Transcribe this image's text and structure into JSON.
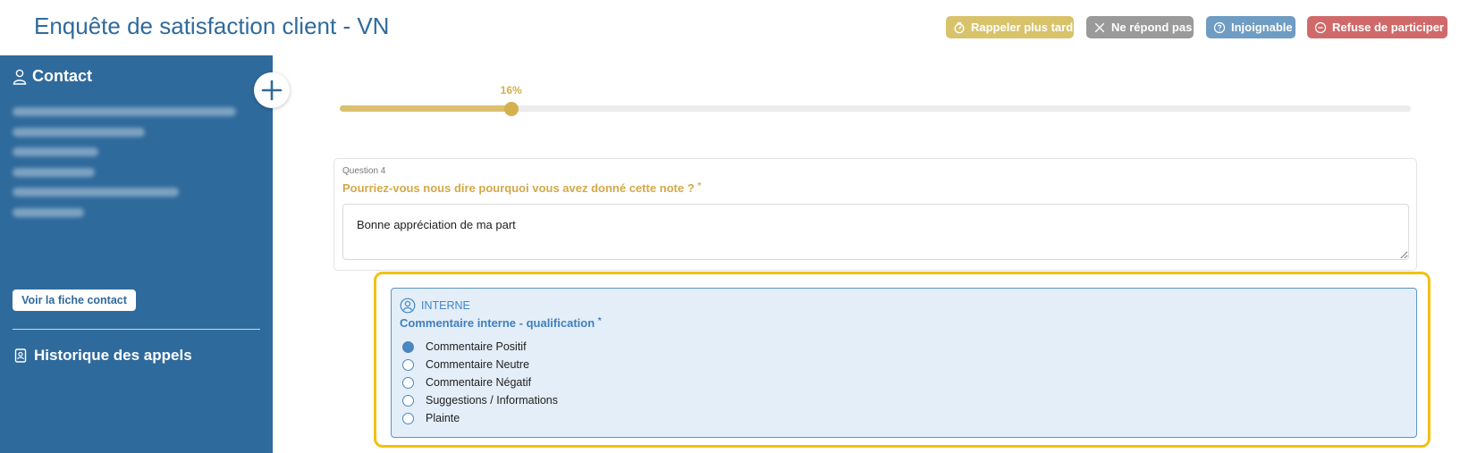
{
  "header": {
    "title": "Enquête de satisfaction client - VN",
    "actions": {
      "callback": "Rappeler plus tard",
      "no_answer": "Ne répond pas",
      "unreachable": "Injoignable",
      "refuse": "Refuse de participer"
    },
    "colors": {
      "callback": "#d8c36a",
      "no_answer": "#9a9a9a",
      "unreachable": "#6f9cc2",
      "refuse": "#d06a6a"
    }
  },
  "sidebar": {
    "contact_heading": "Contact",
    "contact_button": "Voir la fiche contact",
    "history_heading": "Historique des appels",
    "background": "#2f6a9c"
  },
  "progress": {
    "label": "16%",
    "value": 0.16
  },
  "question": {
    "number": "Question 4",
    "text": "Pourriez-vous nous dire pourquoi vous avez donné cette note ?",
    "required_marker": "*",
    "answer": "Bonne appréciation de ma part"
  },
  "internal": {
    "tag": "INTERNE",
    "question": "Commentaire interne - qualification",
    "required_marker": "*",
    "options": [
      "Commentaire Positif",
      "Commentaire Neutre",
      "Commentaire Négatif",
      "Suggestions / Informations",
      "Plainte"
    ],
    "selected_index": 0
  }
}
